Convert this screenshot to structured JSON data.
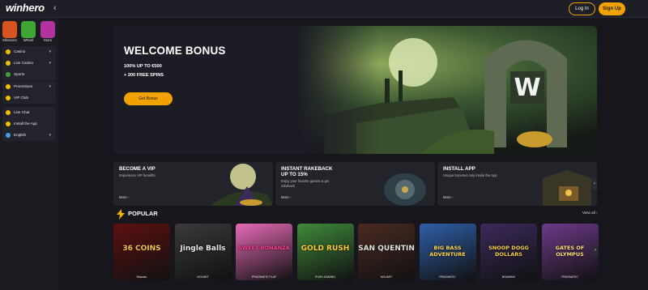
{
  "header": {
    "logo_text": "winhero",
    "login_label": "Log In",
    "signup_label": "Sign Up"
  },
  "sidebar": {
    "quick_links": [
      {
        "label": "Missions",
        "color": "#d9531e"
      },
      {
        "label": "Wheel",
        "color": "#3fa534"
      },
      {
        "label": "Store",
        "color": "#b2329f"
      }
    ],
    "groups": [
      [
        {
          "label": "Casino",
          "icon": "casino-icon",
          "has_chevron": true
        },
        {
          "label": "Live Casino",
          "icon": "live-casino-icon",
          "has_chevron": true
        },
        {
          "label": "Sports",
          "icon": "sports-icon",
          "has_chevron": false
        }
      ],
      [
        {
          "label": "Promotions",
          "icon": "promotions-icon",
          "has_chevron": true
        },
        {
          "label": "VIP Club",
          "icon": "crown-icon",
          "has_chevron": false
        }
      ],
      [
        {
          "label": "Live Chat",
          "icon": "chat-icon",
          "has_chevron": false
        },
        {
          "label": "Install the App",
          "icon": "phone-icon",
          "has_chevron": false
        },
        {
          "label": "English",
          "icon": "globe-icon",
          "has_chevron": true
        }
      ]
    ]
  },
  "hero": {
    "title": "WELCOME BONUS",
    "line1": "100% UP TO €500",
    "line2": "+ 200 FREE SPINS",
    "button_label": "Get Bonus",
    "gate_letter": "W"
  },
  "promos": [
    {
      "title": "BECOME A VIP",
      "subtitle": "Experience VIP benefits",
      "more": "More ›"
    },
    {
      "title": "INSTANT RAKEBACK\nUP TO 15%",
      "subtitle": "Enjoy your favorite games & get rakeback",
      "more": "More ›"
    },
    {
      "title": "INSTALL APP",
      "subtitle": "Unique bonuses only inside the App",
      "more": "More ›"
    }
  ],
  "popular": {
    "title": "POPULAR",
    "view_all": "View all ›",
    "games": [
      {
        "title": "36 COINS",
        "provider": "Wazdan",
        "bg": "#5c1010",
        "fg": "#f4c542"
      },
      {
        "title": "Jingle Balls",
        "provider": "NOLIMIT",
        "bg": "#3a3a3a",
        "fg": "#e8e8e8"
      },
      {
        "title": "SWEET BONANZA",
        "provider": "PRAGMATIC PLAY",
        "bg": "#e86bb8",
        "fg": "#ff3d8c"
      },
      {
        "title": "GOLD RUSH",
        "provider": "PUSH GAMING",
        "bg": "#3f8a3a",
        "fg": "#ffcc33"
      },
      {
        "title": "SAN QUENTIN",
        "provider": "NOLIMIT",
        "bg": "#4a2a22",
        "fg": "#e0e0e0"
      },
      {
        "title": "BIG BASS ADVENTURE",
        "provider": "PRAGMATIC",
        "bg": "#2f5fa8",
        "fg": "#ffd84a"
      },
      {
        "title": "SNOOP DOGG DOLLARS",
        "provider": "BGAMING",
        "bg": "#3b2a5c",
        "fg": "#f4d03f"
      },
      {
        "title": "GATES OF OLYMPUS",
        "provider": "PRAGMATIC",
        "bg": "#6e3a8a",
        "fg": "#ffe17a"
      }
    ]
  },
  "colors": {
    "accent": "#f2a200",
    "background": "#16161c",
    "sidebar": "#1b1b22"
  }
}
